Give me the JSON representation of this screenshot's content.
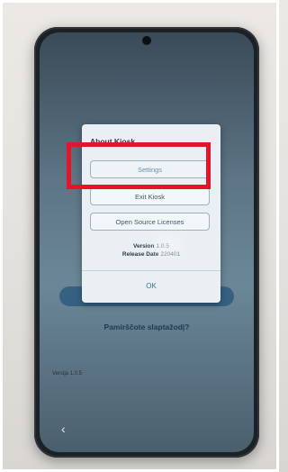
{
  "dialog": {
    "title": "About Kiosk",
    "buttons": {
      "settings": "Settings",
      "exit_kiosk": "Exit Kiosk",
      "open_source_licenses": "Open Source Licenses"
    },
    "version_label": "Version",
    "version_value": "1.0.5",
    "release_date_label": "Release Date",
    "release_date_value": "220401",
    "ok_label": "OK"
  },
  "app_behind": {
    "forgot_link": "Pamirščote slaptažodį?",
    "version_text": "Versija 1.0.5"
  },
  "system_nav": {
    "back_icon": "chevron-left-icon",
    "back_glyph": "‹"
  },
  "colors": {
    "highlight": "#e5142b",
    "dialog_bg": "#e9eff2",
    "ok_text": "#3f6f8d"
  }
}
